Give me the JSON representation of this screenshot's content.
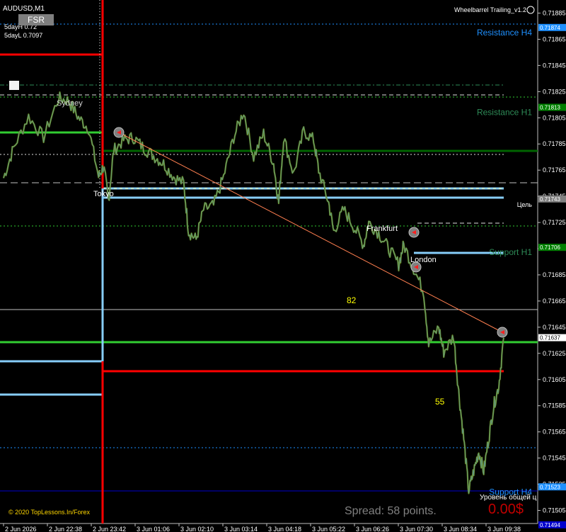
{
  "title": "AUDUSD,M1",
  "indicator_title": "Wheelbarrel Trailing_v1.2",
  "info_lines": [
    "5dayH 0.72",
    "5dayL 0.7097"
  ],
  "fsr_button": "FSR",
  "copyright": "© 2020 TopLessons.In/Forex",
  "spread_text": "Spread: 58 points.",
  "profit_label": "Уровень общей ц",
  "profit_value": "0.00$",
  "colors": {
    "background": "#000000",
    "candles": "#6b8e23",
    "bid_line": "#c0c0c0",
    "green_level": "#32cd32",
    "dark_green_level": "#006400",
    "red_level": "#ff0000",
    "lightblue_level": "#87cefa",
    "dodger_blue": "#1e90ff",
    "yellow_text": "#ffff00",
    "trend_line": "#ff7f50"
  },
  "chart_data": {
    "type": "line",
    "symbol": "AUDUSD",
    "timeframe": "M1",
    "ylim": [
      0.71495,
      0.71895
    ],
    "y_ticks": [
      "0.71885",
      "0.71865",
      "0.71845",
      "0.71825",
      "0.71805",
      "0.71785",
      "0.71765",
      "0.71745",
      "0.71725",
      "0.71705",
      "0.71685",
      "0.71665",
      "0.71645",
      "0.71625",
      "0.71605",
      "0.71585",
      "0.71565",
      "0.71545",
      "0.71525",
      "0.71505"
    ],
    "x_ticks": [
      "2 Jun 2026",
      "2 Jun 22:38",
      "2 Jun 23:42",
      "3 Jun 01:06",
      "3 Jun 02:10",
      "3 Jun 03:14",
      "3 Jun 04:18",
      "3 Jun 05:22",
      "3 Jun 06:26",
      "3 Jun 07:30",
      "3 Jun 08:34",
      "3 Jun 09:38"
    ],
    "price_path": [
      {
        "t": 0.0,
        "p": 0.71759
      },
      {
        "t": 0.02,
        "p": 0.71782
      },
      {
        "t": 0.05,
        "p": 0.71806
      },
      {
        "t": 0.08,
        "p": 0.7179
      },
      {
        "t": 0.11,
        "p": 0.7182
      },
      {
        "t": 0.13,
        "p": 0.71818
      },
      {
        "t": 0.15,
        "p": 0.71805
      },
      {
        "t": 0.17,
        "p": 0.71797
      },
      {
        "t": 0.19,
        "p": 0.7176
      },
      {
        "t": 0.2,
        "p": 0.71768
      },
      {
        "t": 0.21,
        "p": 0.71742
      },
      {
        "t": 0.22,
        "p": 0.7178
      },
      {
        "t": 0.24,
        "p": 0.71788
      },
      {
        "t": 0.26,
        "p": 0.7179
      },
      {
        "t": 0.28,
        "p": 0.71782
      },
      {
        "t": 0.3,
        "p": 0.71776
      },
      {
        "t": 0.32,
        "p": 0.7177
      },
      {
        "t": 0.34,
        "p": 0.7176
      },
      {
        "t": 0.36,
        "p": 0.71755
      },
      {
        "t": 0.37,
        "p": 0.71718
      },
      {
        "t": 0.385,
        "p": 0.71712
      },
      {
        "t": 0.4,
        "p": 0.71735
      },
      {
        "t": 0.42,
        "p": 0.71738
      },
      {
        "t": 0.44,
        "p": 0.7176
      },
      {
        "t": 0.46,
        "p": 0.7179
      },
      {
        "t": 0.48,
        "p": 0.7181
      },
      {
        "t": 0.5,
        "p": 0.71775
      },
      {
        "t": 0.52,
        "p": 0.71793
      },
      {
        "t": 0.54,
        "p": 0.7177
      },
      {
        "t": 0.55,
        "p": 0.7174
      },
      {
        "t": 0.56,
        "p": 0.7179
      },
      {
        "t": 0.58,
        "p": 0.71762
      },
      {
        "t": 0.6,
        "p": 0.71795
      },
      {
        "t": 0.62,
        "p": 0.71788
      },
      {
        "t": 0.63,
        "p": 0.71765
      },
      {
        "t": 0.65,
        "p": 0.7174
      },
      {
        "t": 0.66,
        "p": 0.71718
      },
      {
        "t": 0.68,
        "p": 0.71735
      },
      {
        "t": 0.7,
        "p": 0.71722
      },
      {
        "t": 0.72,
        "p": 0.71708
      },
      {
        "t": 0.73,
        "p": 0.71725
      },
      {
        "t": 0.75,
        "p": 0.71717
      },
      {
        "t": 0.77,
        "p": 0.71705
      },
      {
        "t": 0.79,
        "p": 0.71693
      },
      {
        "t": 0.8,
        "p": 0.71708
      },
      {
        "t": 0.82,
        "p": 0.7169
      },
      {
        "t": 0.84,
        "p": 0.71672
      },
      {
        "t": 0.85,
        "p": 0.71632
      },
      {
        "t": 0.87,
        "p": 0.71645
      },
      {
        "t": 0.88,
        "p": 0.71626
      },
      {
        "t": 0.9,
        "p": 0.71638
      },
      {
        "t": 0.91,
        "p": 0.71595
      },
      {
        "t": 0.92,
        "p": 0.7156
      },
      {
        "t": 0.93,
        "p": 0.7152
      },
      {
        "t": 0.94,
        "p": 0.71535
      },
      {
        "t": 0.95,
        "p": 0.7155
      },
      {
        "t": 0.96,
        "p": 0.71535
      },
      {
        "t": 0.97,
        "p": 0.7156
      },
      {
        "t": 0.98,
        "p": 0.71585
      },
      {
        "t": 0.99,
        "p": 0.716
      },
      {
        "t": 1.0,
        "p": 0.71637
      }
    ],
    "current_price": "0.71637",
    "levels": [
      {
        "label": "Resistance H4",
        "price": "0.71874",
        "style": "dotted-blue"
      },
      {
        "label": "Resistance H1",
        "price": "0.71813",
        "style": "dotted-green"
      },
      {
        "label": "Цель",
        "price": "0.71743",
        "style": "lightblue"
      },
      {
        "label": "Support H1",
        "price": "0.71706",
        "style": "dotted-green"
      },
      {
        "label": "Support H4",
        "price": "0.71523",
        "style": "dotted-blue"
      },
      {
        "label": "",
        "price": "0.71494",
        "style": "blue"
      }
    ],
    "sessions": [
      "Sydney",
      "Tokyo",
      "Frankfurt",
      "London"
    ],
    "annotations": [
      "82",
      "55"
    ]
  }
}
